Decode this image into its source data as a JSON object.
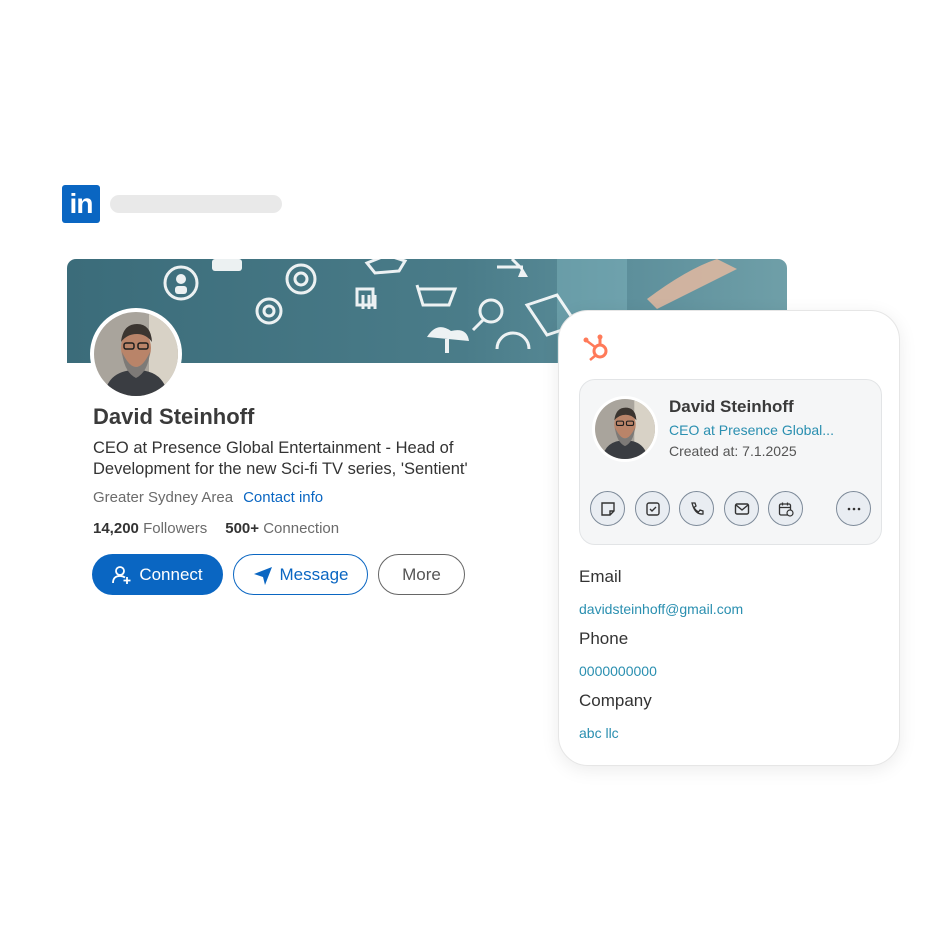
{
  "app": {
    "logo_text": "in"
  },
  "profile": {
    "name": "David Steinhoff",
    "headline": "CEO at Presence Global Entertainment - Head of Development for the new Sci-fi TV series, 'Sentient'",
    "location": "Greater Sydney Area",
    "contact_info_label": "Contact info",
    "followers_count": "14,200",
    "followers_label": "Followers",
    "connections_count": "500+",
    "connections_label": "Connection",
    "buttons": {
      "connect": "Connect",
      "message": "Message",
      "more": "More"
    }
  },
  "hubspot": {
    "contact": {
      "name": "David Steinhoff",
      "title": "CEO at Presence Global...",
      "created": "Created at: 7.1.2025"
    },
    "actions": [
      "note-icon",
      "task-icon",
      "phone-icon",
      "email-icon",
      "meeting-icon",
      "more-icon"
    ],
    "fields": [
      {
        "label": "Email",
        "value": "davidsteinhoff@gmail.com"
      },
      {
        "label": "Phone",
        "value": "0000000000"
      },
      {
        "label": "Company",
        "value": "abc llc"
      }
    ]
  },
  "colors": {
    "linkedin_blue": "#0a66c2",
    "hubspot_orange": "#ff7a59",
    "link_teal": "#2a8fb0"
  }
}
